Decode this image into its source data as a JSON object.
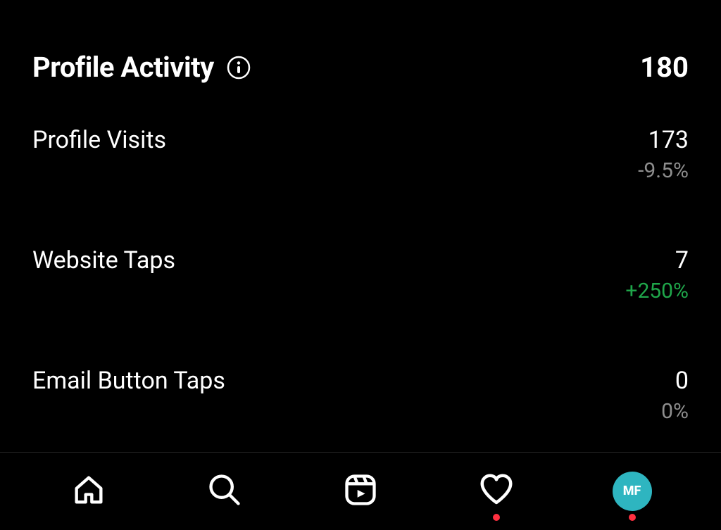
{
  "header": {
    "title": "Profile Activity",
    "total": "180"
  },
  "metrics": [
    {
      "label": "Profile Visits",
      "value": "173",
      "change": "-9.5%",
      "changeType": "neutral"
    },
    {
      "label": "Website Taps",
      "value": "7",
      "change": "+250%",
      "changeType": "positive"
    },
    {
      "label": "Email Button Taps",
      "value": "0",
      "change": "0%",
      "changeType": "neutral"
    }
  ],
  "nav": {
    "avatarInitials": "MF"
  }
}
